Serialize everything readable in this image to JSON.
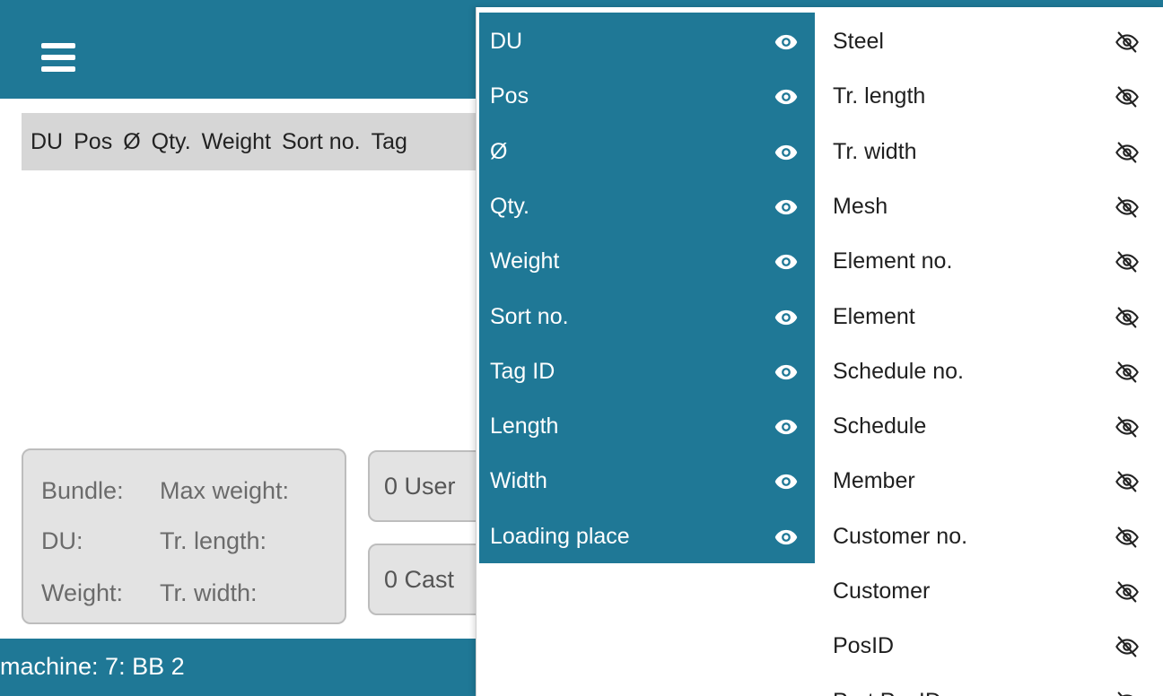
{
  "header": {
    "columns": [
      "DU",
      "Pos",
      "Ø",
      "Qty.",
      "Weight",
      "Sort no.",
      "Tag"
    ]
  },
  "info_panel": {
    "lines": [
      {
        "key": "Bundle:",
        "value": "Max weight:"
      },
      {
        "key": "DU:",
        "value": "Tr. length:"
      },
      {
        "key": "Weight:",
        "value": "Tr. width:"
      }
    ]
  },
  "side_buttons": [
    "0 User",
    "0 Cast"
  ],
  "footer": {
    "machine": "machine: 7: BB 2"
  },
  "column_picker": {
    "visible": [
      "DU",
      "Pos",
      "Ø",
      "Qty.",
      "Weight",
      "Sort no.",
      "Tag ID",
      "Length",
      "Width",
      "Loading place"
    ],
    "hidden": [
      "Steel",
      "Tr. length",
      "Tr. width",
      "Mesh",
      "Element no.",
      "Element",
      "Schedule no.",
      "Schedule",
      "Member",
      "Customer no.",
      "Customer",
      "PosID",
      "Part PosID"
    ]
  },
  "icons": {
    "visible": "eye-icon",
    "hidden": "eye-off-icon"
  },
  "colors": {
    "accent": "#1f7896",
    "panel": "#e3e3e3",
    "header_row": "#d6d6d6"
  }
}
